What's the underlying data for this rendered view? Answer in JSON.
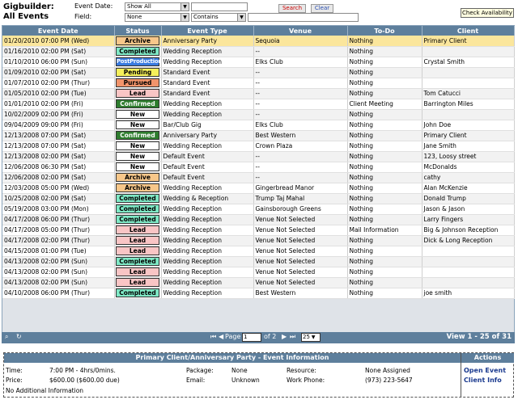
{
  "app": {
    "title_line1": "Gigbuilder:",
    "title_line2": "All Events"
  },
  "filters": {
    "event_date_label": "Event Date:",
    "event_date_value": "Show All",
    "field_label": "Field:",
    "field_value": "None",
    "operator_value": "Contains",
    "search_label": "Search",
    "clear_label": "Clear",
    "check_availability_label": "Check Availability"
  },
  "columns": [
    "Event Date",
    "Status",
    "Event Type",
    "Venue",
    "To-Do",
    "Client"
  ],
  "status_colors": {
    "Archive": "#f7c78a",
    "Completed": "#7fe9c6",
    "PostProduction": "#3a7be0",
    "Pending": "#f5f05a",
    "Pursued": "#f2946b",
    "Lead": "#f9c5c5",
    "Confirmed": "#2e7d2e",
    "New": "#ffffff"
  },
  "rows": [
    {
      "date": "01/20/2010 07:00 PM (Wed)",
      "status": "Archive",
      "type": "Anniversary Party",
      "venue": "Sequoia",
      "todo": "Nothing",
      "client": "Primary Client"
    },
    {
      "date": "01/16/2010 02:00 PM (Sat)",
      "status": "Completed",
      "type": "Wedding Reception",
      "venue": "--",
      "todo": "Nothing",
      "client": ""
    },
    {
      "date": "01/10/2010 06:00 PM (Sun)",
      "status": "PostProduction",
      "type": "Wedding Reception",
      "venue": "Elks Club",
      "todo": "Nothing",
      "client": " Crystal Smith"
    },
    {
      "date": "01/09/2010 02:00 PM (Sat)",
      "status": "Pending",
      "type": "Standard Event",
      "venue": "--",
      "todo": "Nothing",
      "client": ""
    },
    {
      "date": "01/07/2010 02:00 PM (Thur)",
      "status": "Pursued",
      "type": "Standard Event",
      "venue": "--",
      "todo": "Nothing",
      "client": ""
    },
    {
      "date": "01/05/2010 02:00 PM (Tue)",
      "status": "Lead",
      "type": "Standard Event",
      "venue": "--",
      "todo": "Nothing",
      "client": "Tom Catucci"
    },
    {
      "date": "01/01/2010 02:00 PM (Fri)",
      "status": "Confirmed",
      "type": "Wedding Reception",
      "venue": "--",
      "todo": "Client Meeting",
      "client": "Barrington Miles"
    },
    {
      "date": "10/02/2009 02:00 PM (Fri)",
      "status": "New",
      "type": "Wedding Reception",
      "venue": "--",
      "todo": "Nothing",
      "client": ""
    },
    {
      "date": "09/04/2009 09:00 PM (Fri)",
      "status": "New",
      "type": "Bar/Club Gig",
      "venue": "Elks Club",
      "todo": "Nothing",
      "client": "John Doe"
    },
    {
      "date": "12/13/2008 07:00 PM (Sat)",
      "status": "Confirmed",
      "type": "Anniversary Party",
      "venue": "Best Western",
      "todo": "Nothing",
      "client": "Primary Client"
    },
    {
      "date": "12/13/2008 07:00 PM (Sat)",
      "status": "New",
      "type": "Wedding Reception",
      "venue": "Crown Plaza",
      "todo": "Nothing",
      "client": "Jane Smith"
    },
    {
      "date": "12/13/2008 02:00 PM (Sat)",
      "status": "New",
      "type": "Default Event",
      "venue": "--",
      "todo": "Nothing",
      "client": "123, Loosy street"
    },
    {
      "date": "12/06/2008 06:30 PM (Sat)",
      "status": "New",
      "type": "Default Event",
      "venue": "--",
      "todo": "Nothing",
      "client": "McDonalds"
    },
    {
      "date": "12/06/2008 02:00 PM (Sat)",
      "status": "Archive",
      "type": "Default Event",
      "venue": "--",
      "todo": "Nothing",
      "client": "cathy"
    },
    {
      "date": "12/03/2008 05:00 PM (Wed)",
      "status": "Archive",
      "type": "Wedding Reception",
      "venue": "Gingerbread Manor",
      "todo": "Nothing",
      "client": "Alan McKenzie"
    },
    {
      "date": "10/25/2008 02:00 PM (Sat)",
      "status": "Completed",
      "type": "Wedding & Reception",
      "venue": "Trump Taj Mahal",
      "todo": "Nothing",
      "client": "Donald Trump"
    },
    {
      "date": "05/19/2008 03:00 PM (Mon)",
      "status": "Completed",
      "type": "Wedding Reception",
      "venue": "Gainsborough Greens",
      "todo": "Nothing",
      "client": "Jason & Jason"
    },
    {
      "date": "04/17/2008 06:00 PM (Thur)",
      "status": "Completed",
      "type": "Wedding Reception",
      "venue": "Venue Not Selected",
      "todo": "Nothing",
      "client": "Larry Fingers"
    },
    {
      "date": "04/17/2008 05:00 PM (Thur)",
      "status": "Lead",
      "type": "Wedding Reception",
      "venue": "Venue Not Selected",
      "todo": "Mail Information",
      "client": "Big & Johnson Reception"
    },
    {
      "date": "04/17/2008 02:00 PM (Thur)",
      "status": "Lead",
      "type": "Wedding Reception",
      "venue": "Venue Not Selected",
      "todo": "Nothing",
      "client": "Dick & Long Reception"
    },
    {
      "date": "04/15/2008 01:00 PM (Tue)",
      "status": "Lead",
      "type": "Wedding Reception",
      "venue": "Venue Not Selected",
      "todo": "Nothing",
      "client": ""
    },
    {
      "date": "04/13/2008 02:00 PM (Sun)",
      "status": "Completed",
      "type": "Wedding Reception",
      "venue": "Venue Not Selected",
      "todo": "Nothing",
      "client": ""
    },
    {
      "date": "04/13/2008 02:00 PM (Sun)",
      "status": "Lead",
      "type": "Wedding Reception",
      "venue": "Venue Not Selected",
      "todo": "Nothing",
      "client": ""
    },
    {
      "date": "04/13/2008 02:00 PM (Sun)",
      "status": "Lead",
      "type": "Wedding Reception",
      "venue": "Venue Not Selected",
      "todo": "Nothing",
      "client": ""
    },
    {
      "date": "04/10/2008 06:00 PM (Thur)",
      "status": "Completed",
      "type": "Wedding Reception",
      "venue": "Best Western",
      "todo": "Nothing",
      "client": "joe smith"
    }
  ],
  "pager": {
    "page_label": "Page",
    "page_value": "1",
    "of_label": "of 2",
    "page_size": "25",
    "view_text": "View 1 - 25 of 31",
    "first_icon": "first-page-icon",
    "prev_icon": "prev-page-icon",
    "next_icon": "next-page-icon",
    "last_icon": "last-page-icon"
  },
  "info": {
    "header": "Primary Client/Anniversary Party - Event Information",
    "actions_header": "Actions",
    "time_label": "Time:",
    "time_value": "7:00 PM - 4hrs/0mins.",
    "price_label": "Price:",
    "price_value": "$600.00 ($600.00 due)",
    "package_label": "Package:",
    "package_value": "None",
    "email_label": "Email:",
    "email_value": "Unknown",
    "resource_label": "Resource:",
    "resource_value": "None Assigned",
    "work_phone_label": "Work Phone:",
    "work_phone_value": "(973) 223-5647",
    "additional": "No Additional Information",
    "open_event": "Open Event",
    "client_info": "Client Info"
  }
}
